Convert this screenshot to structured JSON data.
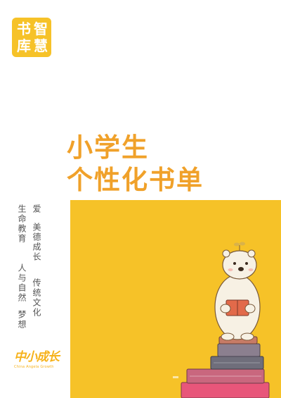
{
  "logo_badge": {
    "chars": [
      "书",
      "智",
      "库",
      "慧"
    ]
  },
  "title": {
    "line1": "小学生",
    "line2": "个性化书单"
  },
  "themes": {
    "col1": "生命教育",
    "col2": "人与自然",
    "col3": "梦想",
    "col4": "爱",
    "col5": "美德成长",
    "col6": "传统文化"
  },
  "brand": {
    "name": "中小成长",
    "subtitle": "China Angela Growth"
  },
  "colors": {
    "accent_yellow": "#F6C228",
    "title_orange": "#F0A12A"
  },
  "icons": {
    "illustration": "polar-bear-reading-on-books-illustration"
  }
}
